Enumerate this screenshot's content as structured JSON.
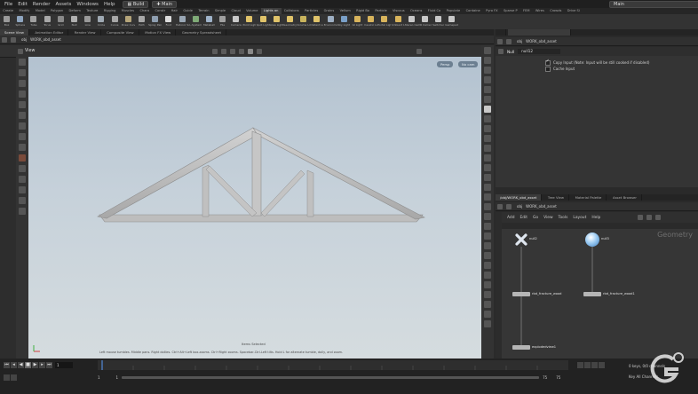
{
  "menubar": {
    "items": [
      "File",
      "Edit",
      "Render",
      "Assets",
      "Windows",
      "Help"
    ],
    "desktop": "Build",
    "context": "Main",
    "right_context": "Main"
  },
  "shelf": {
    "tabs": [
      "Create",
      "Modify",
      "Model",
      "Polygon",
      "Deform",
      "Texture",
      "Rigging",
      "Muscles",
      "Chara",
      "Constr",
      "Hair",
      "Guide",
      "Terrain",
      "Simple",
      "Cloud",
      "Volume",
      "Lights an",
      "Collisions",
      "Particles",
      "Grains",
      "Vellum",
      "Rigid Bo",
      "Particle",
      "Viscous",
      "Oceans",
      "Fluid Co",
      "Populate",
      "Containe",
      "Pyro FX",
      "Sparse P",
      "FEM",
      "Wires",
      "Crowds",
      "Drive Si"
    ],
    "active_tab": "Lights an",
    "tools": [
      "Box",
      "Sphere",
      "Tube",
      "Torus",
      "Grid",
      "Null",
      "Line",
      "Circle",
      "Curve",
      "Draw Curve",
      "Path",
      "Spray Paint",
      "Font",
      "Platonic Solids",
      "L-System",
      "Metaball",
      "File",
      "Camera",
      "Point Light",
      "Spot Light",
      "Area Light",
      "Geometry Light",
      "Volume Light",
      "Distant Light",
      "Environment Light",
      "Sky Light",
      "GI Light",
      "Caustic Light",
      "Portal Light",
      "Ambient Light",
      "Stereo Camera",
      "VR Camera",
      "Switcher",
      "Gamepad Camera"
    ],
    "tool_colors": [
      "#9a9a9a",
      "#8fa6c0",
      "#a0a0a0",
      "#a8a8a8",
      "#8a8a8a",
      "#b0b0b0",
      "#9a9a9a",
      "#9fa9b3",
      "#a7a7a7",
      "#b5a57a",
      "#a8a8a8",
      "#8e9eb0",
      "#dcdcdc",
      "#9aa7b5",
      "#7faa77",
      "#9fb3c9",
      "#a0a0a0",
      "#c8c8c8",
      "#e0c36a",
      "#e0c36a",
      "#e0c36a",
      "#e0c36a",
      "#c9b45d",
      "#e0c36a",
      "#9fb0c4",
      "#7aa0c8",
      "#d8b45c",
      "#d8b45c",
      "#d8b45c",
      "#d8b45c",
      "#c8c8c8",
      "#c8c8c8",
      "#c8c8c8",
      "#c8c8c8"
    ]
  },
  "left_tabs": [
    "Scene View",
    "Animation Editor",
    "Render View",
    "Composite View",
    "Motion FX View",
    "Geometry Spreadsheet"
  ],
  "left_path": [
    "obj",
    "WORK_obd_asset"
  ],
  "viewport": {
    "label": "View",
    "persp_label": "Persp",
    "cam_label": "No cam",
    "status_text": "Left mouse tumbles. Middle pans. Right dollies. Ctrl+Alt+Left box-zooms. Ctrl+Right zooms. Spacebar-Ctrl-Left tilts. Hold L for alternate tumble, dolly, and zoom.",
    "selection_text": "Items Selected"
  },
  "param_pane": {
    "tabs": [
      "obj",
      "WORK_obd_asset"
    ],
    "node_type": "Null",
    "node_name": "null12",
    "params": [
      {
        "checked": true,
        "label": "Copy Input (Note: Input will be still cooked if disabled)"
      },
      {
        "checked": false,
        "label": "Cache Input"
      }
    ]
  },
  "network": {
    "tabs": [
      "/obj/WORK_obd_asset",
      "Tree View",
      "Material Palette",
      "Asset Browser"
    ],
    "path": [
      "obj",
      "WORK_obd_asset"
    ],
    "menu": [
      "Add",
      "Edit",
      "Go",
      "View",
      "Tools",
      "Layout",
      "Help"
    ],
    "context_label": "Geometry",
    "nodes": [
      {
        "name": "null2",
        "icon": "x"
      },
      {
        "name": "null3",
        "icon": "sphere"
      },
      {
        "name": "rbd_fracture_wood"
      },
      {
        "name": "rbd_fracture_wood1"
      },
      {
        "name": "explodedview1"
      }
    ]
  },
  "timeline": {
    "frame": "1",
    "start": "1",
    "start2": "1",
    "end": "75",
    "end2": "75",
    "keys_label": "0 keys, 0/0 channels",
    "key_all": "Key All Channels"
  },
  "colors": {
    "viewport_top": "#b3c2d0",
    "viewport_bottom": "#d5dcdf",
    "truss": "#c9c9c9",
    "network_bg": "#363636",
    "node_white": "#d0d0d0",
    "timeline_bg": "#222222"
  }
}
